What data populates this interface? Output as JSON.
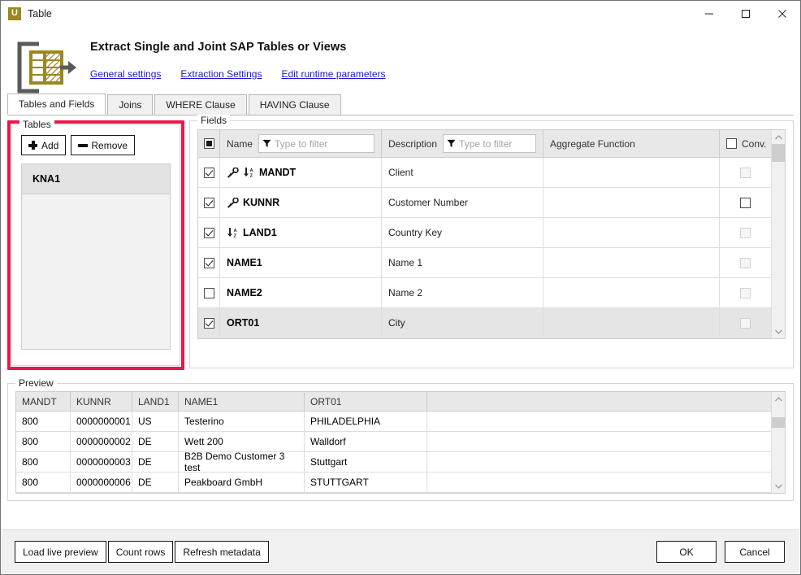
{
  "window": {
    "title": "Table",
    "app_icon_letter": "U",
    "app_icon_color": "#9a8820",
    "minimize": "–",
    "maximize": "□",
    "close": "✕"
  },
  "banner": {
    "title": "Extract Single and Joint SAP Tables or Views",
    "links": [
      {
        "label": "General settings"
      },
      {
        "label": "Extraction Settings"
      },
      {
        "label": "Edit runtime parameters"
      }
    ]
  },
  "tabs": [
    {
      "label": "Tables and Fields",
      "active": true
    },
    {
      "label": "Joins",
      "active": false
    },
    {
      "label": "WHERE Clause",
      "active": false
    },
    {
      "label": "HAVING Clause",
      "active": false
    }
  ],
  "highlight_color": "#e8174b",
  "tables_panel": {
    "group_label": "Tables",
    "add_label": "Add",
    "remove_label": "Remove",
    "items": [
      {
        "name": "KNA1"
      }
    ]
  },
  "fields_panel": {
    "group_label": "Fields",
    "columns": {
      "select_all_state": "indeterminate",
      "name_header": "Name",
      "name_filter_placeholder": "Type to filter",
      "name_filter_value": "",
      "description_header": "Description",
      "description_filter_placeholder": "Type to filter",
      "description_filter_value": "",
      "aggregate_header": "Aggregate Function",
      "conv_header": "Conv.",
      "conv_header_checked": false
    },
    "rows": [
      {
        "checked": true,
        "key": true,
        "sort": true,
        "name": "MANDT",
        "description": "Client",
        "aggregate": "",
        "conv_checked": false,
        "conv_enabled": false,
        "selected": false
      },
      {
        "checked": true,
        "key": true,
        "sort": false,
        "name": "KUNNR",
        "description": "Customer Number",
        "aggregate": "",
        "conv_checked": false,
        "conv_enabled": true,
        "selected": false
      },
      {
        "checked": true,
        "key": false,
        "sort": true,
        "name": "LAND1",
        "description": "Country Key",
        "aggregate": "",
        "conv_checked": false,
        "conv_enabled": false,
        "selected": false
      },
      {
        "checked": true,
        "key": false,
        "sort": false,
        "name": "NAME1",
        "description": "Name 1",
        "aggregate": "",
        "conv_checked": false,
        "conv_enabled": false,
        "selected": false
      },
      {
        "checked": false,
        "key": false,
        "sort": false,
        "name": "NAME2",
        "description": "Name 2",
        "aggregate": "",
        "conv_checked": false,
        "conv_enabled": false,
        "selected": false
      },
      {
        "checked": true,
        "key": false,
        "sort": false,
        "name": "ORT01",
        "description": "City",
        "aggregate": "",
        "conv_checked": false,
        "conv_enabled": false,
        "selected": true
      }
    ]
  },
  "preview": {
    "group_label": "Preview",
    "columns": [
      "MANDT",
      "KUNNR",
      "LAND1",
      "NAME1",
      "ORT01",
      ""
    ],
    "rows": [
      [
        "800",
        "0000000001",
        "US",
        "Testerino",
        "PHILADELPHIA",
        ""
      ],
      [
        "800",
        "0000000002",
        "DE",
        "Wett 200",
        "Walldorf",
        ""
      ],
      [
        "800",
        "0000000003",
        "DE",
        "B2B Demo Customer 3 test",
        "Stuttgart",
        ""
      ],
      [
        "800",
        "0000000006",
        "DE",
        "Peakboard GmbH",
        "STUTTGART",
        ""
      ]
    ]
  },
  "footer": {
    "load_live_preview": "Load live preview",
    "count_rows": "Count rows",
    "refresh_metadata": "Refresh metadata",
    "ok": "OK",
    "cancel": "Cancel"
  }
}
